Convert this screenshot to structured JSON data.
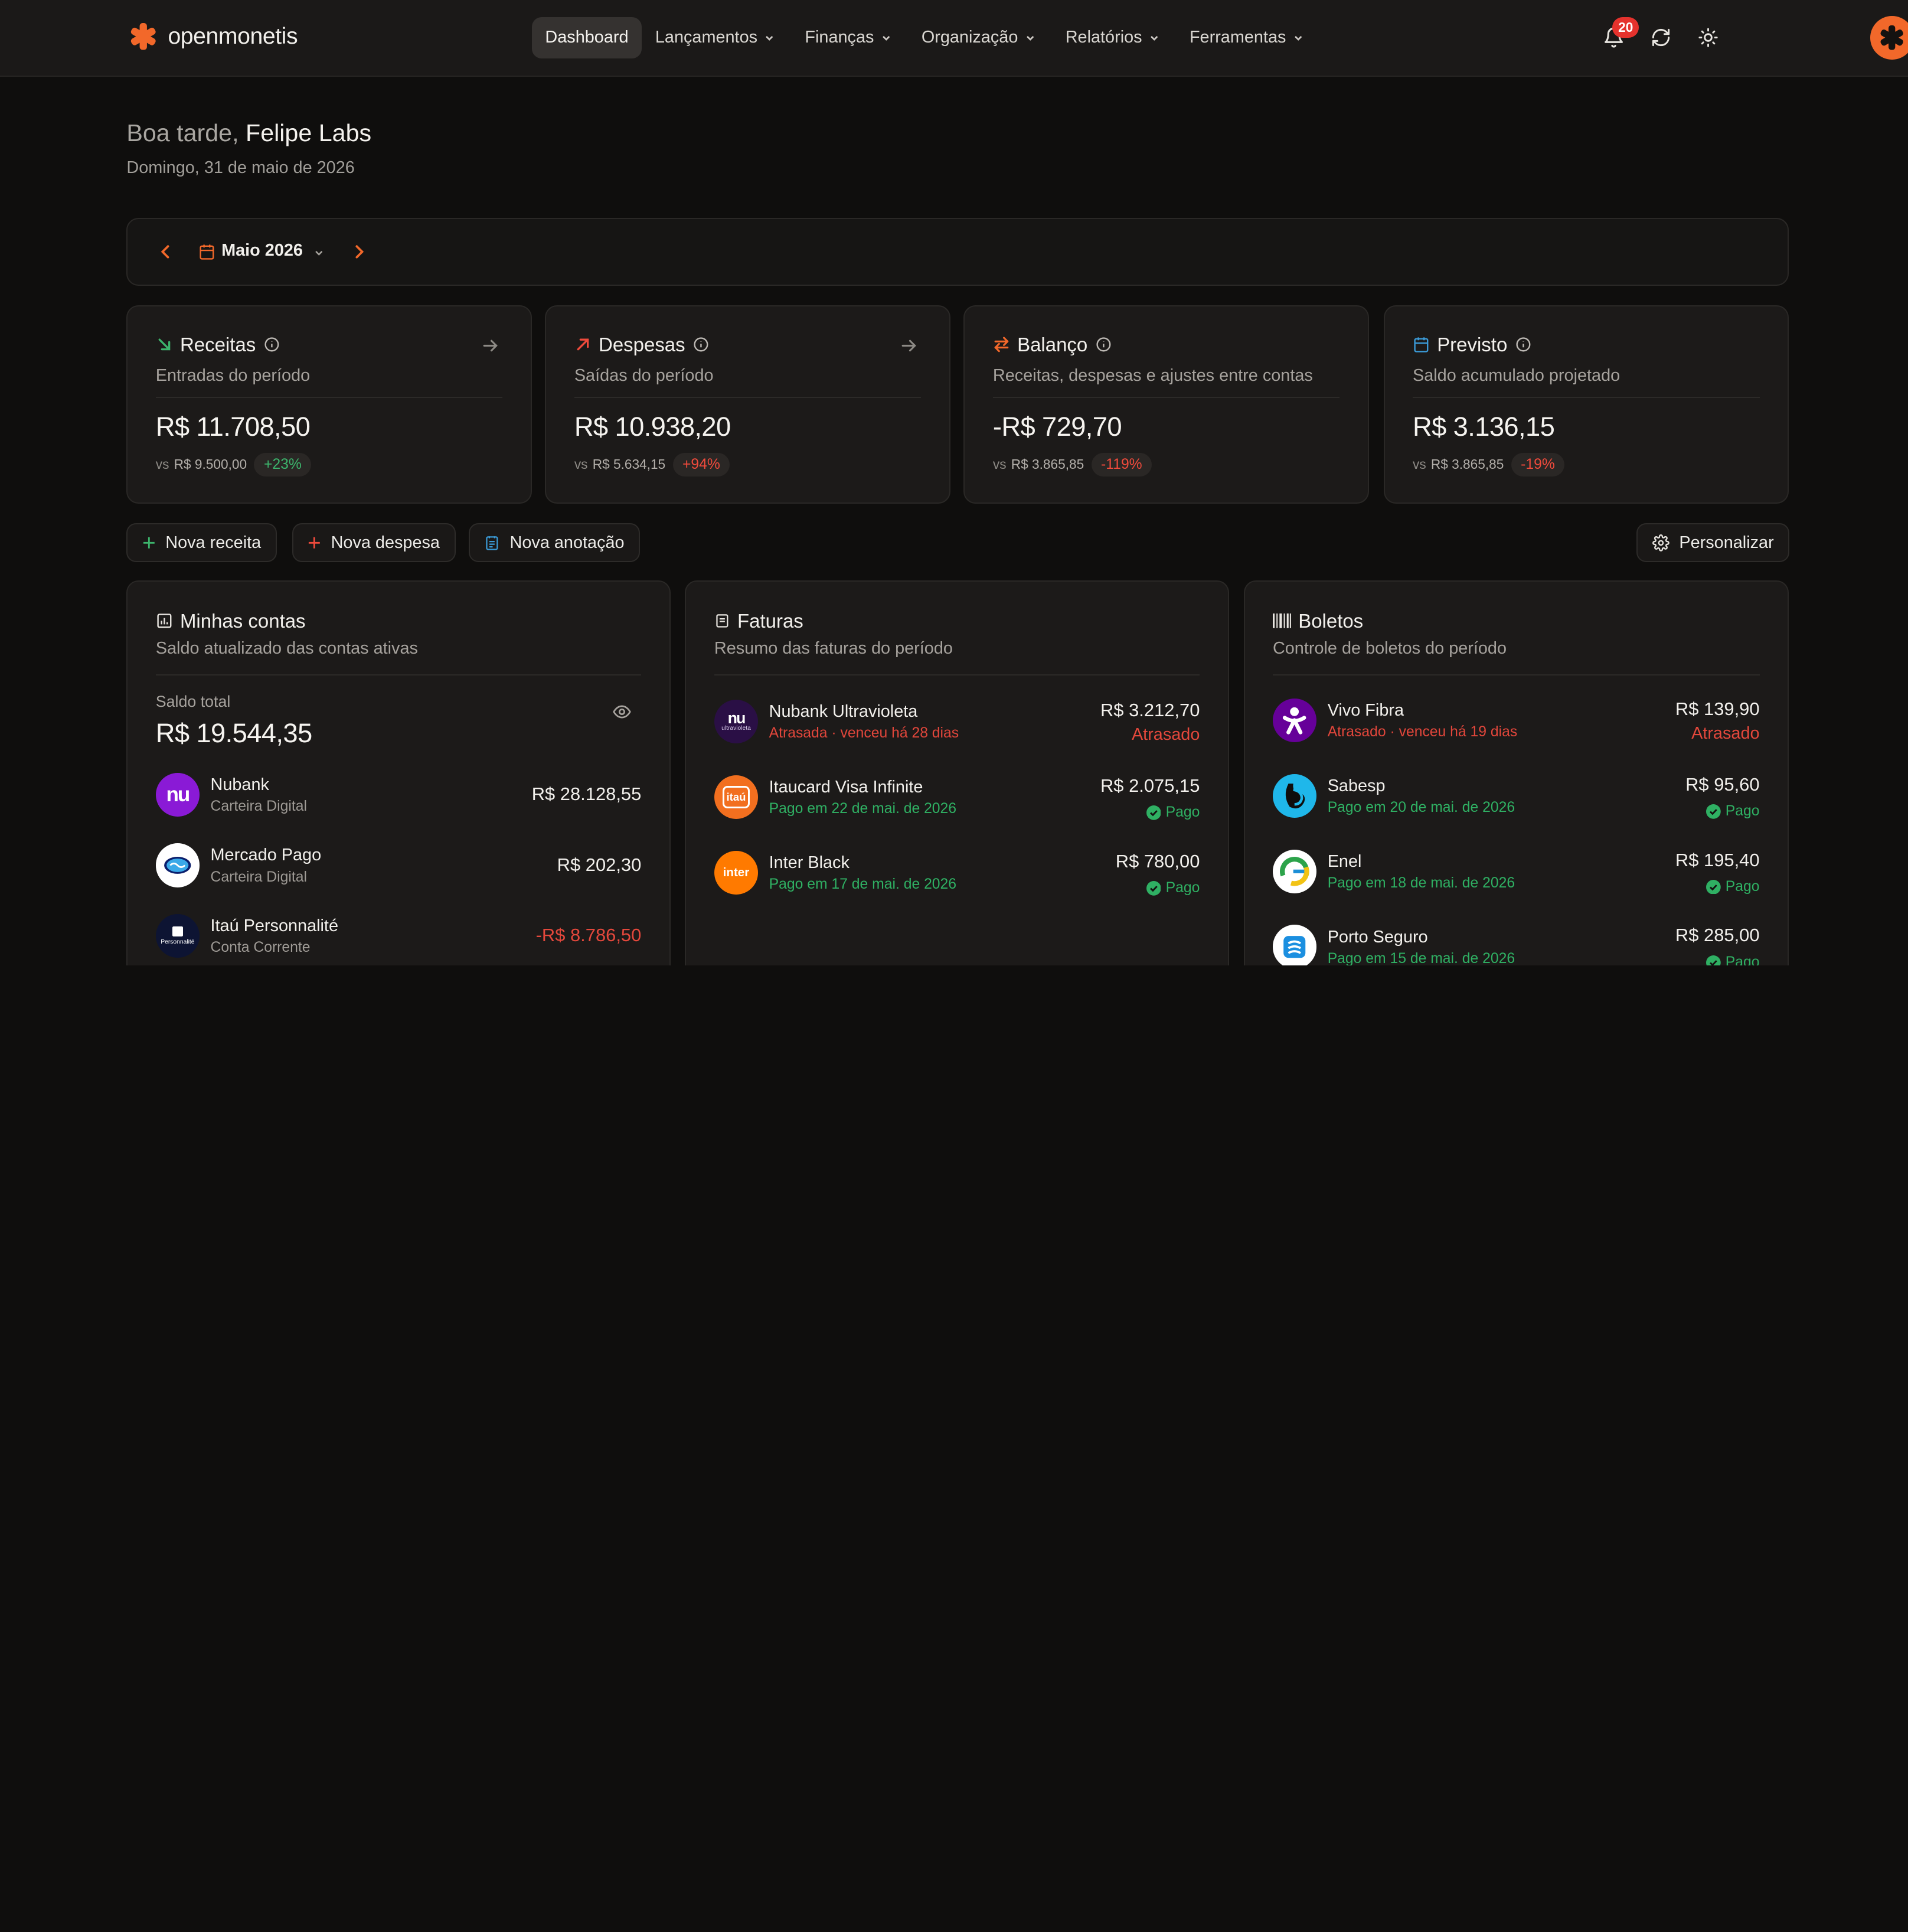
{
  "brand": {
    "name": "openmonetis",
    "accent": "#f2682a"
  },
  "nav": {
    "items": [
      {
        "label": "Dashboard",
        "active": true
      },
      {
        "label": "Lançamentos"
      },
      {
        "label": "Finanças"
      },
      {
        "label": "Organização"
      },
      {
        "label": "Relatórios"
      },
      {
        "label": "Ferramentas"
      }
    ],
    "notifications_count": "20"
  },
  "greeting": {
    "prefix": "Boa tarde,",
    "name": "Felipe Labs",
    "date": "Domingo, 31 de maio de 2026"
  },
  "period": {
    "label": "Maio 2026"
  },
  "stats": [
    {
      "title": "Receitas",
      "subtitle": "Entradas do período",
      "value": "R$ 11.708,50",
      "vs": "vs",
      "previous": "R$ 9.500,00",
      "change": "+23%",
      "trend": "up",
      "icon": "arrow-down-right-icon"
    },
    {
      "title": "Despesas",
      "subtitle": "Saídas do período",
      "value": "R$ 10.938,20",
      "vs": "vs",
      "previous": "R$ 5.634,15",
      "change": "+94%",
      "trend": "down",
      "icon": "arrow-up-right-icon"
    },
    {
      "title": "Balanço",
      "subtitle": "Receitas, despesas e ajustes entre contas",
      "value": "-R$ 729,70",
      "vs": "vs",
      "previous": "R$ 3.865,85",
      "change": "-119%",
      "trend": "down",
      "icon": "swap-icon"
    },
    {
      "title": "Previsto",
      "subtitle": "Saldo acumulado projetado",
      "value": "R$ 3.136,15",
      "vs": "vs",
      "previous": "R$ 3.865,85",
      "change": "-19%",
      "trend": "down",
      "icon": "calendar-icon"
    }
  ],
  "actions": {
    "new_income": "Nova receita",
    "new_expense": "Nova despesa",
    "new_note": "Nova anotação",
    "customize": "Personalizar"
  },
  "accounts": {
    "title": "Minhas contas",
    "subtitle": "Saldo atualizado das contas ativas",
    "total_label": "Saldo total",
    "total_value": "R$ 19.544,35",
    "items": [
      {
        "name": "Nubank",
        "type": "Carteira Digital",
        "amount": "R$ 28.128,55",
        "negative": false,
        "logo_text": "nu"
      },
      {
        "name": "Mercado Pago",
        "type": "Carteira Digital",
        "amount": "R$ 202,30",
        "negative": false
      },
      {
        "name": "Itaú Personnalité",
        "type": "Conta Corrente",
        "amount": "-R$ 8.786,50",
        "negative": true,
        "logo_text": "Personnalité"
      }
    ]
  },
  "invoices": {
    "title": "Faturas",
    "subtitle": "Resumo das faturas do período",
    "items": [
      {
        "name": "Nubank Ultravioleta",
        "detail": "Atrasada · venceu há 28 dias",
        "amount": "R$ 3.212,70",
        "status": "Atrasado",
        "state": "late",
        "logo_text": "nu",
        "logo_sub": "ultravioleta"
      },
      {
        "name": "Itaucard Visa Infinite",
        "detail": "Pago em 22 de mai. de 2026",
        "amount": "R$ 2.075,15",
        "status": "Pago",
        "state": "paid",
        "logo_text": "itaú"
      },
      {
        "name": "Inter Black",
        "detail": "Pago em 17 de mai. de 2026",
        "amount": "R$ 780,00",
        "status": "Pago",
        "state": "paid",
        "logo_text": "inter"
      }
    ]
  },
  "bills": {
    "title": "Boletos",
    "subtitle": "Controle de boletos do período",
    "items": [
      {
        "name": "Vivo Fibra",
        "detail": "Atrasado · venceu há 19 dias",
        "amount": "R$ 139,90",
        "status": "Atrasado",
        "state": "late"
      },
      {
        "name": "Sabesp",
        "detail": "Pago em 20 de mai. de 2026",
        "amount": "R$ 95,60",
        "status": "Pago",
        "state": "paid"
      },
      {
        "name": "Enel",
        "detail": "Pago em 18 de mai. de 2026",
        "amount": "R$ 195,40",
        "status": "Pago",
        "state": "paid"
      },
      {
        "name": "Porto Seguro",
        "detail": "Pago em 15 de mai. de 2026",
        "amount": "R$ 285,00",
        "status": "Pago",
        "state": "paid"
      }
    ]
  },
  "colors": {
    "positive": "#2fb063",
    "negative": "#e4483c",
    "accent": "#f2682a",
    "info": "#3b9bd8"
  }
}
